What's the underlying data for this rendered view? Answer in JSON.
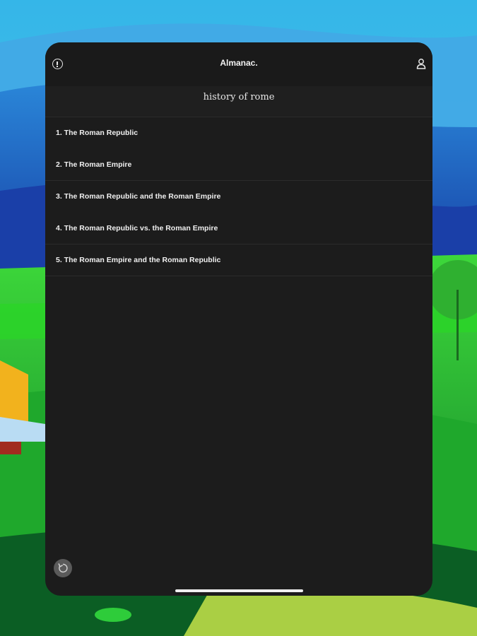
{
  "header": {
    "title": "Almanac.",
    "info_icon": "info-icon",
    "user_icon": "user-icon"
  },
  "query": "history of rome",
  "results": [
    "1. The Roman Republic",
    "2. The Roman Empire",
    "3. The Roman Republic and the Roman Empire",
    "4. The Roman Republic vs. the Roman Empire",
    "5. The Roman Empire and the Roman Republic"
  ],
  "footer": {
    "reset_icon": "refresh-icon"
  },
  "colors": {
    "panel": "#1c1c1c",
    "text": "#f0f0f0",
    "sky": "#2aa7e0",
    "grass": "#2fd02a"
  }
}
